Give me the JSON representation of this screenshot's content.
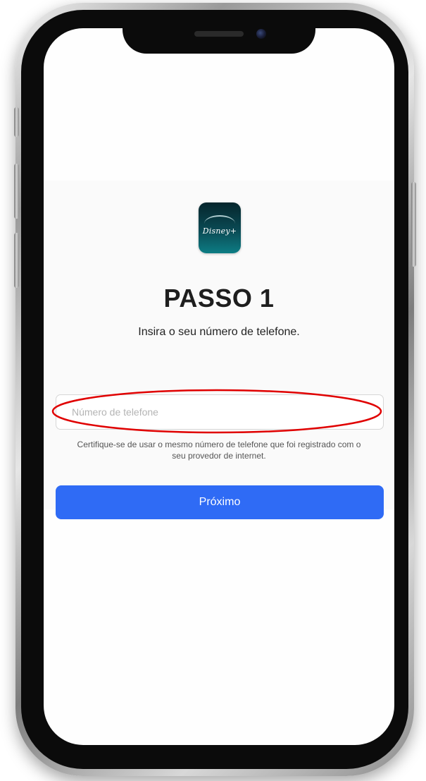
{
  "app": {
    "logo_text": "Disney+",
    "icon_colors": [
      "#06262c",
      "#0d7d84"
    ]
  },
  "step": {
    "title": "PASSO 1",
    "instruction": "Insira o seu número de telefone."
  },
  "phone_field": {
    "placeholder": "Número de telefone",
    "value": ""
  },
  "helper_text": "Certifique-se de usar o mesmo número de telefone que foi registrado com o seu provedor de internet.",
  "next_button": {
    "label": "Próximo",
    "color": "#2f6bf5"
  },
  "annotation": {
    "shape": "ellipse",
    "color": "#e00000",
    "target": "phone_field"
  }
}
